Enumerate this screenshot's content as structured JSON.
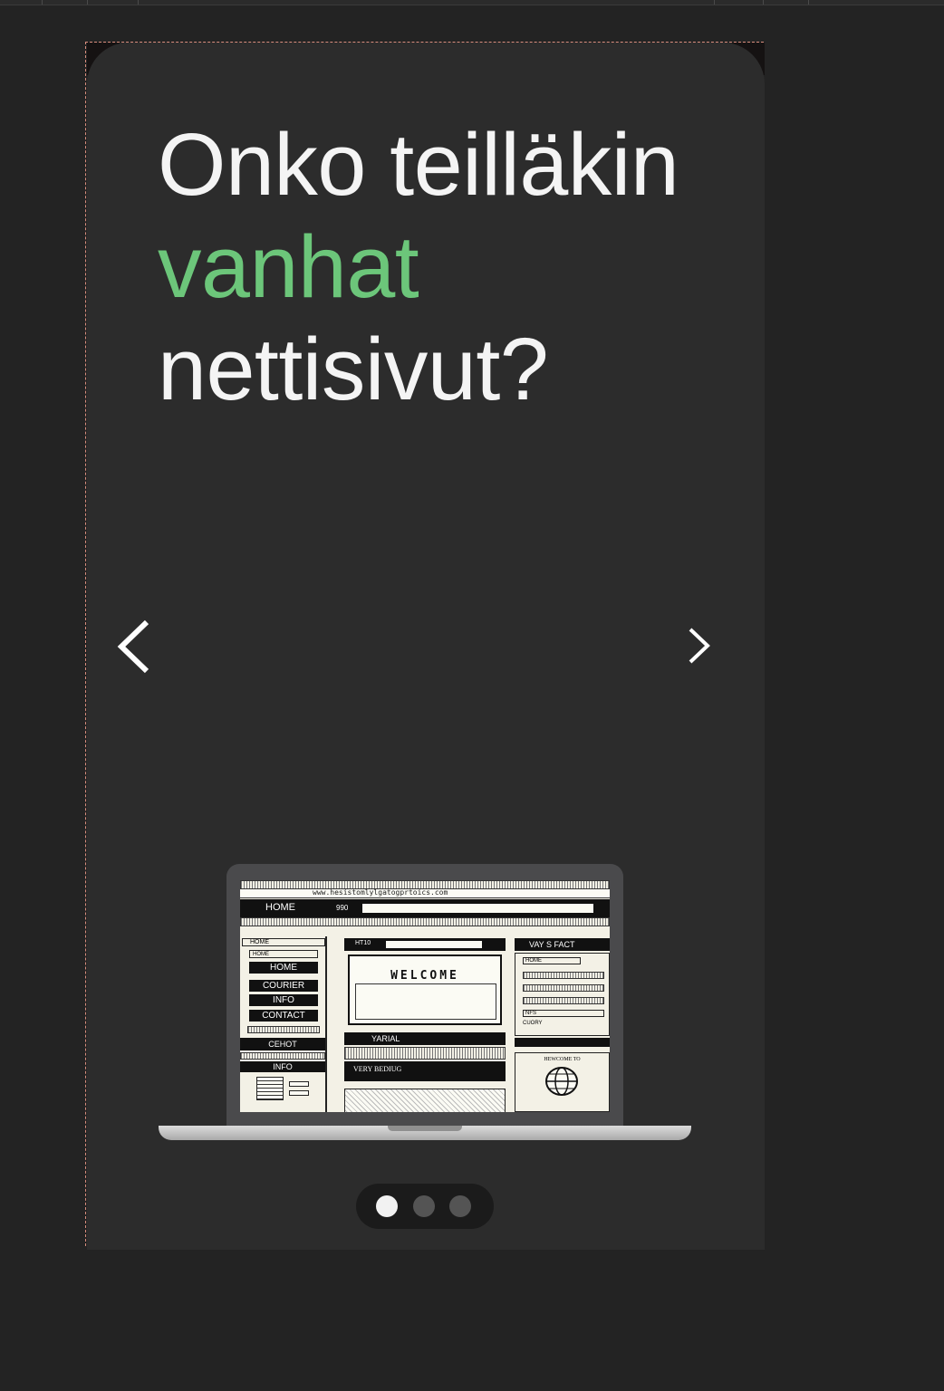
{
  "hero": {
    "title_line1": "Onko teilläkin",
    "title_accent": "vanhat",
    "title_line3": "nettisivut?"
  },
  "colors": {
    "accent": "#6cc67a",
    "card_bg": "#2c2c2c",
    "page_bg": "#232323",
    "text": "#f4f4f4"
  },
  "carousel": {
    "prev_icon": "chevron-left-icon",
    "next_icon": "chevron-right-icon",
    "slide_count": 3,
    "active_index": 0
  },
  "retro_site": {
    "url": "www.hesistomlylgatogprtoics.com",
    "home_tab": "HOME",
    "address_num": "990",
    "nav_header": "HOME",
    "nav_sub": "HOME",
    "nav_items": [
      "HOME",
      "COURIER",
      "INFO",
      "CONTACT"
    ],
    "nav_footer": "CEHOT",
    "info_header": "INFO",
    "center_label": "HT10",
    "welcome": "WELCOME",
    "font_label": "YARIAL",
    "very_label": "VERY BEDIUG",
    "right_header": "VAY  S  FACT",
    "right_field1": "HOME",
    "right_field2": "NFS",
    "right_field3": "CUORY",
    "right_bottom": "HEWCOME TO"
  }
}
